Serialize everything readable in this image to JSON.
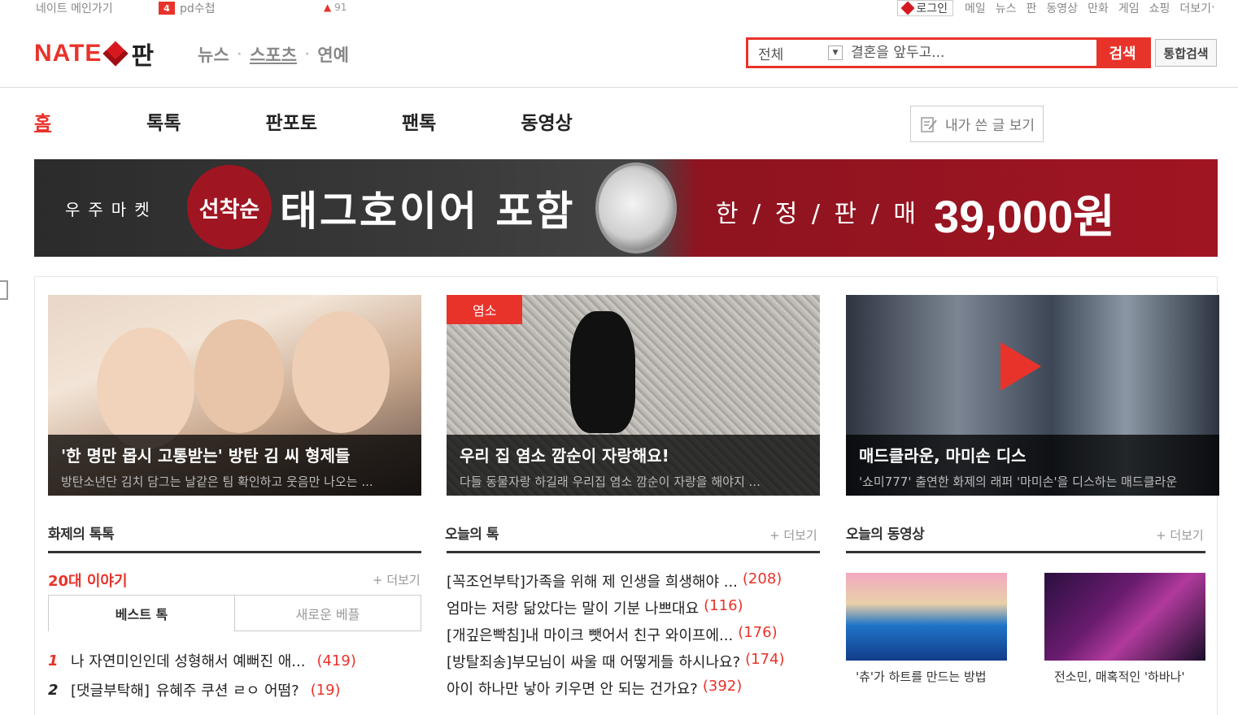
{
  "util": {
    "main_link": "네이트 메인가기",
    "pd_badge": "4",
    "pd_label": "pd수첩",
    "up_count": "91",
    "login": "로그인",
    "links": [
      "메일",
      "뉴스",
      "판",
      "동영상",
      "만화",
      "게임",
      "쇼핑",
      "더보기"
    ]
  },
  "header": {
    "logo_nate": "NATE",
    "logo_pan": "판",
    "nav": [
      "뉴스",
      "스포츠",
      "연예"
    ],
    "search_scope": "전체",
    "search_placeholder": "결혼을 앞두고...",
    "search_button": "검색",
    "total_search": "통합검색"
  },
  "tabs": [
    "홈",
    "톡톡",
    "판포토",
    "팬톡",
    "동영상"
  ],
  "my_posts": "내가 쓴 글 보기",
  "banner": {
    "shop": "우주마켓",
    "badge": "선착순",
    "headline": "태그호이어 포함",
    "limited": "한 / 정 / 판 / 매",
    "price": "39,000원"
  },
  "cards": [
    {
      "title": "'한 명만 몹시 고통받는' 방탄 김 씨 형제들",
      "desc": "방탄소년단 김치 담그는 날같은 팀 확인하고 웃음만 나오는 ...",
      "tag": ""
    },
    {
      "title": "우리 집 염소 깜순이 자랑해요!",
      "desc": "다들 동물자랑 하길래 우리집 염소 깜순이 자랑을 해야지 ...",
      "tag": "염소"
    },
    {
      "title": "매드클라운, 마미손 디스",
      "desc": "'쇼미777' 출연한 화제의 래퍼 '마미손'을 디스하는 매드클라운",
      "tag": ""
    }
  ],
  "columns": {
    "hot_title": "화제의 톡톡",
    "age_title": "20대 이야기",
    "more": "+ 더보기",
    "subtab_best": "베스트 톡",
    "subtab_new": "새로운 베플",
    "best": [
      {
        "rank": "1",
        "title": "나 자연미인인데 성형해서 예뻐진 애...",
        "count": "(419)"
      },
      {
        "rank": "2",
        "prefix": "[댓글부탁해]",
        "title": "유혜주 쿠션 ㄹㅇ 어떰?",
        "count": "(19)"
      }
    ],
    "today_title": "오늘의 톡",
    "today": [
      {
        "text": "[꼭조언부탁]가족을 위해 제 인생을 희생해야 ...",
        "count": "(208)"
      },
      {
        "text": "엄마는 저랑 닮았다는 말이 기분 나쁘대요",
        "count": "(116)"
      },
      {
        "text": "[개깊은빡침]내 마이크 뺏어서 친구 와이프에...",
        "count": "(176)"
      },
      {
        "text": "[방탈죄송]부모님이 싸울 때 어떻게들 하시나요?",
        "count": "(174)"
      },
      {
        "text": "아이 하나만 낳아 키우면 안 되는 건가요?",
        "count": "(392)"
      }
    ],
    "video_title": "오늘의 동영상",
    "videos": [
      "'츄'가 하트를 만드는 방법",
      "전소민, 매혹적인 '하바나'"
    ]
  },
  "colors": {
    "accent": "#e8332b",
    "banner_red": "#a01522"
  }
}
